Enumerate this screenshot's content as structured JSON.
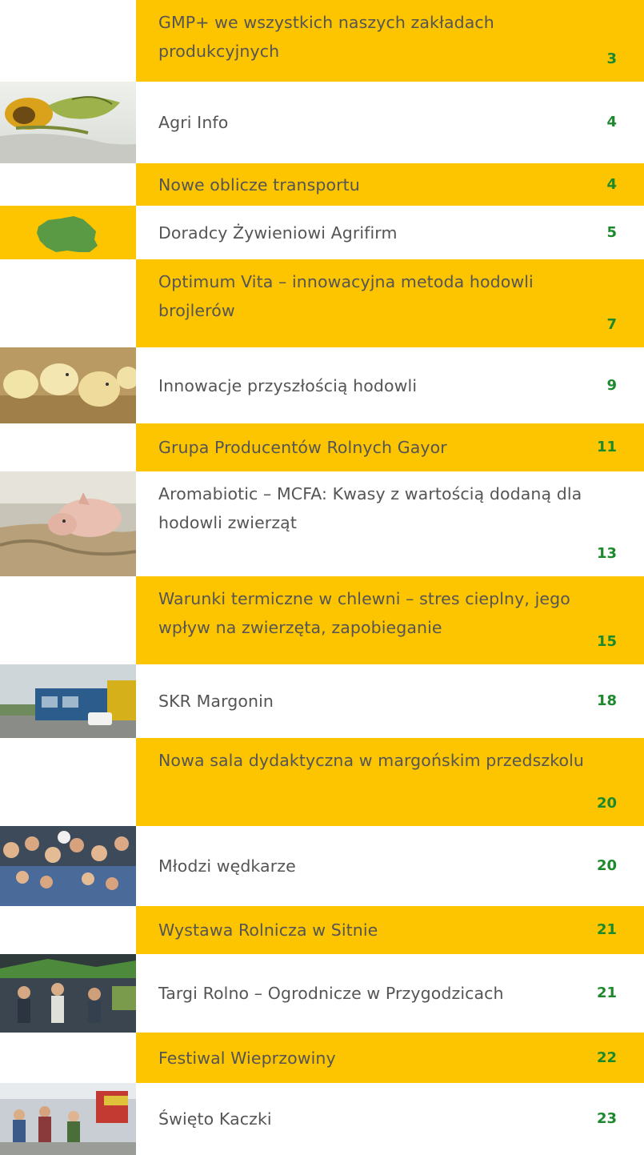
{
  "toc": {
    "entries": [
      {
        "title": "GMP+ we wszystkich naszych zakładach produkcyjnych",
        "page": "3"
      },
      {
        "title": "Agri Info",
        "page": "4"
      },
      {
        "title": "Nowe oblicze transportu",
        "page": "4"
      },
      {
        "title": "Doradcy Żywieniowi Agrifirm",
        "page": "5"
      },
      {
        "title": "Optimum Vita – innowacyjna metoda hodowli brojlerów",
        "page": "7"
      },
      {
        "title": "Innowacje przyszłością hodowli",
        "page": "9"
      },
      {
        "title": "Grupa Producentów Rolnych Gayor",
        "page": "11"
      },
      {
        "title": "Aromabiotic – MCFA: Kwasy z wartością dodaną dla hodowli zwierząt",
        "page": "13"
      },
      {
        "title": "Warunki termiczne w chlewni – stres cieplny, jego wpływ na zwierzęta, zapobieganie",
        "page": "15"
      },
      {
        "title": "SKR Margonin",
        "page": "18"
      },
      {
        "title": "Nowa sala dydaktyczna w margońskim przedszkolu",
        "page": "20"
      },
      {
        "title": "Młodzi wędkarze",
        "page": "20"
      },
      {
        "title": "Wystawa Rolnicza w Sitnie",
        "page": "21"
      },
      {
        "title": "Targi Rolno – Ogrodnicze w Przygodzicach",
        "page": "21"
      },
      {
        "title": "Festiwal Wieprzowiny",
        "page": "22"
      },
      {
        "title": "Święto Kaczki",
        "page": "23"
      }
    ]
  },
  "colors": {
    "accent_yellow": "#fdc400",
    "page_number_green": "#1c8a2c",
    "title_gray": "#555555"
  },
  "thumbnails": [
    "sunflower-photo",
    "poland-map-icon",
    "chicks-photo",
    "piglet-photo",
    "building-photo",
    "crowd-photo",
    "fair-photo",
    "festival-photo"
  ]
}
